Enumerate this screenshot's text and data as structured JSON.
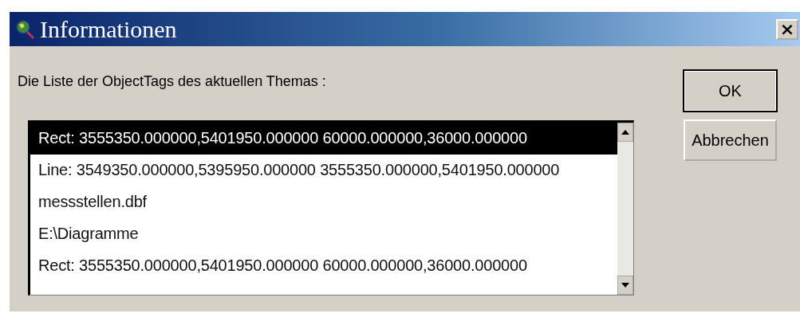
{
  "window": {
    "title": "Informationen",
    "close": "×"
  },
  "prompt": "Die Liste der ObjectTags des aktuellen Themas :",
  "list": [
    {
      "text": "Rect: 3555350.000000,5401950.000000 60000.000000,36000.000000",
      "selected": true
    },
    {
      "text": "Line: 3549350.000000,5395950.000000 3555350.000000,5401950.000000",
      "selected": false
    },
    {
      "text": "messstellen.dbf",
      "selected": false
    },
    {
      "text": "E:\\Diagramme",
      "selected": false
    },
    {
      "text": "Rect: 3555350.000000,5401950.000000 60000.000000,36000.000000",
      "selected": false
    }
  ],
  "buttons": [
    {
      "label": "OK",
      "default": true
    },
    {
      "label": "Abbrechen",
      "default": false
    }
  ]
}
